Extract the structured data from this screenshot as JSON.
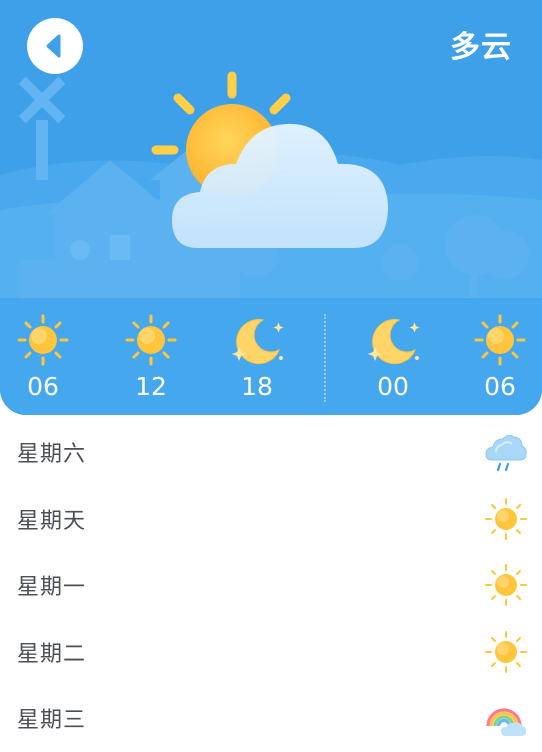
{
  "header": {
    "condition": "多云",
    "back_icon": "back-arrow-icon",
    "main_icon": "partly-cloudy-icon"
  },
  "hourly": [
    {
      "time": "06",
      "icon": "sun-icon"
    },
    {
      "time": "12",
      "icon": "sun-icon"
    },
    {
      "time": "18",
      "icon": "moon-icon"
    },
    {
      "time": "00",
      "icon": "moon-icon"
    },
    {
      "time": "06",
      "icon": "sun-icon"
    }
  ],
  "daily": [
    {
      "day": "星期六",
      "icon": "rain-cloud-icon"
    },
    {
      "day": "星期天",
      "icon": "sun-icon"
    },
    {
      "day": "星期一",
      "icon": "sun-icon"
    },
    {
      "day": "星期二",
      "icon": "sun-icon"
    },
    {
      "day": "星期三",
      "icon": "rainbow-cloud-icon"
    }
  ],
  "colors": {
    "header_blue": "#3fa0ea",
    "sun": "#ffc53d",
    "text": "#4a4f57"
  }
}
